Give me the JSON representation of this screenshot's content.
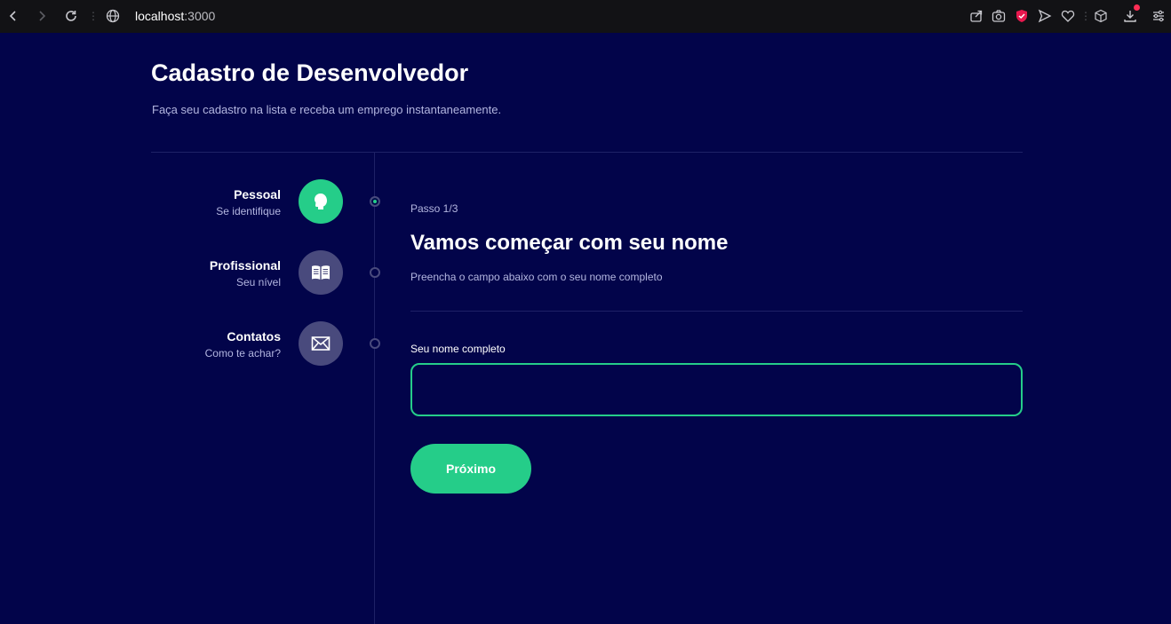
{
  "browser": {
    "url_host": "localhost",
    "url_port": ":3000"
  },
  "page": {
    "title": "Cadastro de Desenvolvedor",
    "subtitle": "Faça seu cadastro na lista e receba um emprego instantaneamente."
  },
  "steps": [
    {
      "title": "Pessoal",
      "desc": "Se identifique",
      "icon": "person-head-icon",
      "active": true
    },
    {
      "title": "Profissional",
      "desc": "Seu nível",
      "icon": "book-icon",
      "active": false
    },
    {
      "title": "Contatos",
      "desc": "Como te achar?",
      "icon": "mail-icon",
      "active": false
    }
  ],
  "form": {
    "step_label": "Passo 1/3",
    "title": "Vamos começar com seu nome",
    "description": "Preencha o campo abaixo com o seu nome completo",
    "field_label": "Seu nome completo",
    "field_value": "",
    "next_label": "Próximo"
  },
  "colors": {
    "background": "#02044a",
    "accent": "#25cd89",
    "inactive": "#494a7d",
    "divider": "#1e2166"
  }
}
